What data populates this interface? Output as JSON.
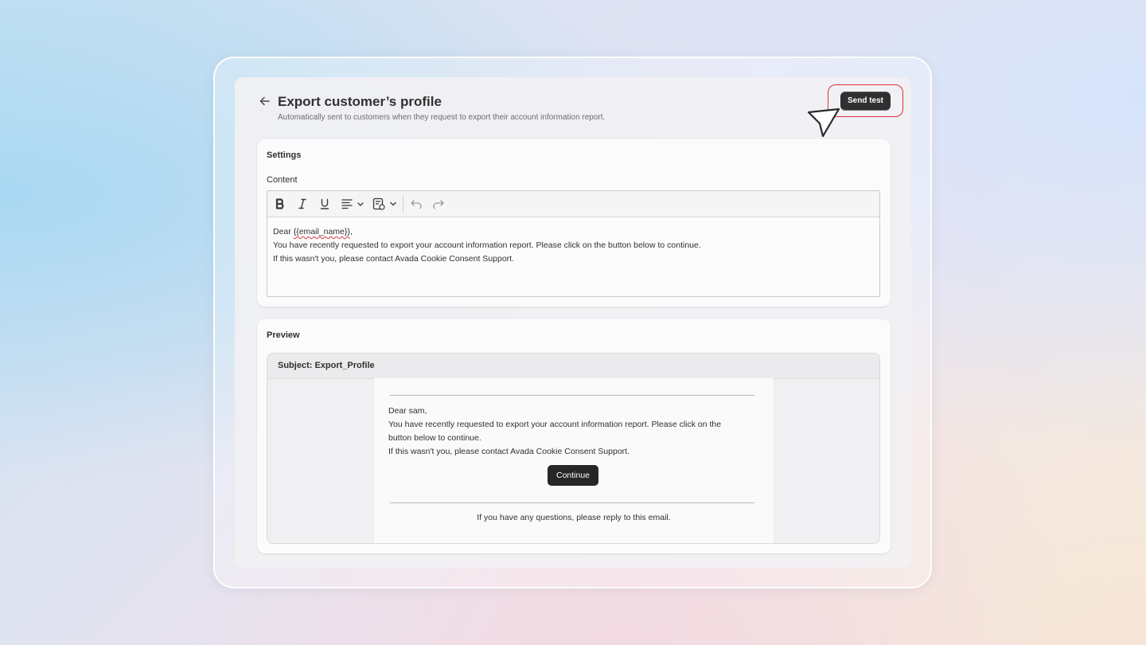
{
  "header": {
    "title": "Export customer’s profile",
    "subtitle": "Automatically sent to customers when they request to export their account information report.",
    "send_test_label": "Send test"
  },
  "settings": {
    "title": "Settings",
    "content_label": "Content",
    "toolbar": {
      "items": [
        "bold-icon",
        "italic-icon",
        "underline-icon",
        "align-icon",
        "insert-variable-icon",
        "undo-icon",
        "redo-icon"
      ]
    },
    "editor": {
      "line1_prefix": "Dear ",
      "line1_variable": "{{email_name}}",
      "line1_suffix": ",",
      "line2": "You have recently requested to export your account information report. Please click on the button below to continue.",
      "line3": "If this wasn't you, please contact Avada Cookie Consent Support."
    }
  },
  "preview": {
    "title": "Preview",
    "subject": "Subject: Export_Profile",
    "email": {
      "greeting": "Dear sam,",
      "line2a": "You have recently requested to export your account information report. Please click on the",
      "line2b": "button below to continue.",
      "line3": "If this wasn't you, please contact Avada Cookie Consent Support.",
      "button_label": "Continue",
      "footer": "If you have any questions, please reply to this email."
    }
  },
  "colors": {
    "highlight": "#e0303a",
    "primary_button": "#303030"
  }
}
